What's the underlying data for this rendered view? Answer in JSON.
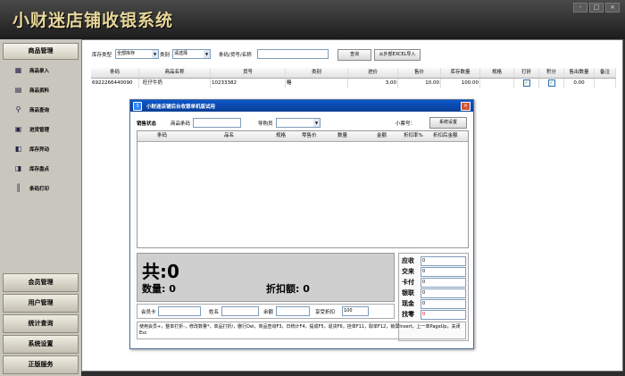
{
  "app": {
    "title": "小财迷店铺收银系统"
  },
  "window_controls": [
    "-",
    "□",
    "×"
  ],
  "sidebar": {
    "header": "商品管理",
    "items": [
      {
        "label": "商品录入",
        "icon": "product-entry-icon"
      },
      {
        "label": "商品资料",
        "icon": "product-info-icon"
      },
      {
        "label": "商品查询",
        "icon": "search-icon"
      },
      {
        "label": "进货管理",
        "icon": "purchase-icon"
      },
      {
        "label": "库存异动",
        "icon": "stock-change-icon"
      },
      {
        "label": "库存盘点",
        "icon": "inventory-icon"
      },
      {
        "label": "条码打印",
        "icon": "barcode-icon"
      }
    ],
    "bottom": [
      "会员管理",
      "用户管理",
      "统计查询",
      "系统设置",
      "正版服务"
    ]
  },
  "filter": {
    "stock_type_label": "库存类型",
    "stock_type_value": "全部库存",
    "category_label": "类别",
    "category_value": "请选择",
    "search_label": "条码/货号/名称",
    "search_value": "",
    "query_button": "查询",
    "import_button": "从外部EXCEL导入"
  },
  "product_table": {
    "columns": [
      "条码",
      "商品名称",
      "货号",
      "类别",
      "进价",
      "售价",
      "库存数量",
      "规格",
      "打折",
      "积分",
      "售出数量",
      "备注"
    ],
    "rows": [
      {
        "barcode": "6922266440090",
        "name": "旺仔牛奶",
        "item_no": "10233382",
        "category": "糖",
        "cost": "3.00",
        "price": "10.00",
        "stock": "100.00",
        "spec": "",
        "discount": true,
        "points": true,
        "sold": "0.00",
        "note": ""
      }
    ]
  },
  "pos": {
    "title": "小财迷店铺后台收银单机版试用",
    "sale_status_label": "销售状态",
    "barcode_label": "商品条码",
    "barcode_value": "",
    "guide_label": "导购员",
    "guide_value": "",
    "ticket_label": "小票号：",
    "settings_button": "系统设置",
    "columns": [
      "条码",
      "品名",
      "规格",
      "零售价",
      "数量",
      "金额",
      "折扣率%",
      "折扣后金额"
    ],
    "total_label": "共:",
    "total_value": "0",
    "qty_label": "数量:",
    "qty_value": "0",
    "discount_amount_label": "折扣额:",
    "discount_amount_value": "0",
    "payments": [
      {
        "label": "应收",
        "value": "0",
        "color": "#000000"
      },
      {
        "label": "交来",
        "value": "0",
        "color": "#000000"
      },
      {
        "label": "卡付",
        "value": "0",
        "color": "#000000"
      },
      {
        "label": "银联",
        "value": "0",
        "color": "#000000"
      },
      {
        "label": "现金",
        "value": "0",
        "color": "#000000"
      },
      {
        "label": "找零",
        "value": "0",
        "color": "#d00000"
      }
    ],
    "member_card_label": "会员卡",
    "member_card_value": "",
    "name_label": "姓名",
    "name_value": "",
    "balance_label": "余额",
    "balance_value": "",
    "member_discount_label": "享受折扣",
    "member_discount_value": "100",
    "hint": "使用会员+，整单打折-，修改数量*，单品打折/，删行Del，商品查询F3，日统计F4，提成F5，退货F6，挂单F11，取单F12，锁屏Insert，上一单PageUp，关闭Esc"
  }
}
